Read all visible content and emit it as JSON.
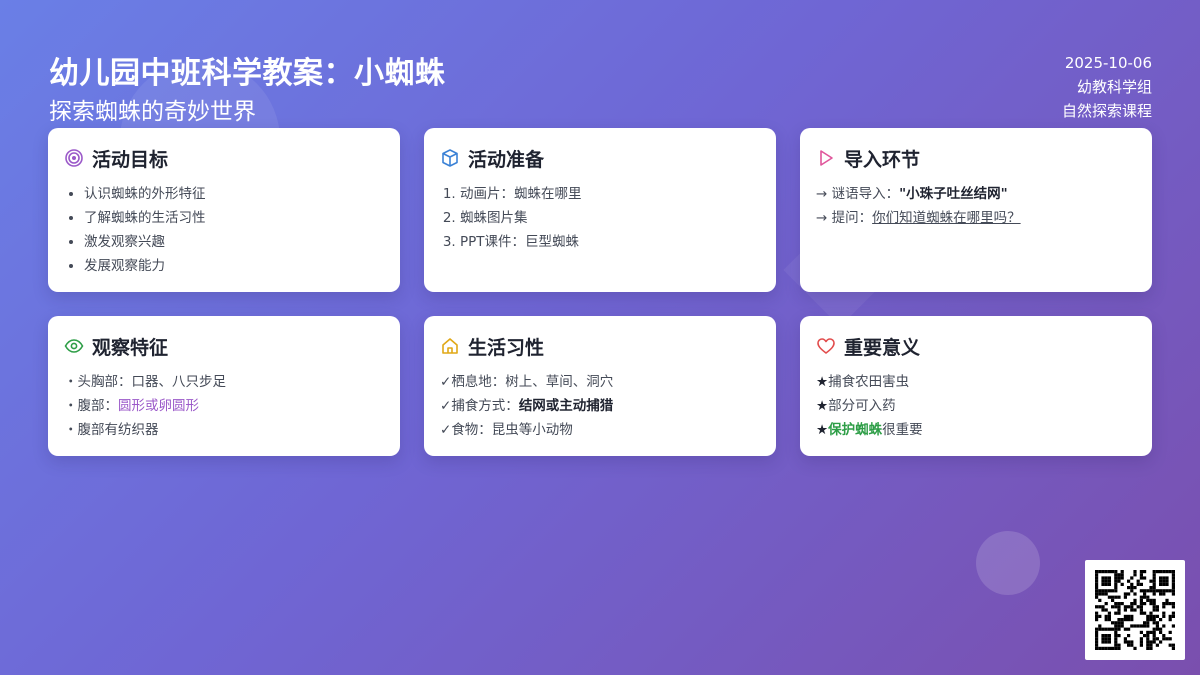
{
  "header": {
    "title": "幼儿园中班科学教案：小蜘蛛",
    "subtitle": "探索蜘蛛的奇妙世界",
    "date": "2025-10-06",
    "group": "幼教科学组",
    "course": "自然探索课程"
  },
  "cards": {
    "goals": {
      "title": "活动目标",
      "icon": "target-icon",
      "items": [
        "认识蜘蛛的外形特征",
        "了解蜘蛛的生活习性",
        "激发观察兴趣",
        "发展观察能力"
      ]
    },
    "prep": {
      "title": "活动准备",
      "icon": "box-icon",
      "items": [
        "动画片：蜘蛛在哪里",
        "蜘蛛图片集",
        "PPT课件：巨型蜘蛛"
      ]
    },
    "intro": {
      "title": "导入环节",
      "icon": "play-icon",
      "line1_prefix": "→ 谜语导入：",
      "line1_value": "\"小珠子吐丝结网\"",
      "line2_prefix": "→ 提问：",
      "line2_value": "你们知道蜘蛛在哪里吗？"
    },
    "features": {
      "title": "观察特征",
      "icon": "eye-icon",
      "bullet": "・",
      "line1": "头胸部：口器、八只步足",
      "line2_prefix": "腹部：",
      "line2_value": "圆形或卵圆形",
      "line3": "腹部有纺织器"
    },
    "habits": {
      "title": "生活习性",
      "icon": "home-icon",
      "check": "✓",
      "line1": "栖息地：树上、草间、洞穴",
      "line2_prefix": "捕食方式：",
      "line2_value": "结网或主动捕猎",
      "line3": "食物：昆虫等小动物"
    },
    "meaning": {
      "title": "重要意义",
      "icon": "heart-icon",
      "star": "★",
      "line1": "捕食农田害虫",
      "line2": "部分可入药",
      "line3_value": "保护蜘蛛",
      "line3_suffix": "很重要"
    }
  },
  "colors": {
    "target": "#9b59c9",
    "box": "#3b82d6",
    "play": "#e0569b",
    "eye": "#2e9e47",
    "home": "#e0a817",
    "heart": "#e24c4c"
  },
  "qr": {
    "icon": "qr-code-icon"
  }
}
